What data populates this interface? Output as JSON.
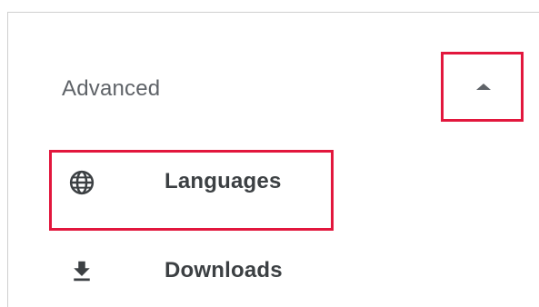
{
  "section": {
    "title": "Advanced",
    "toggle_icon": "arrow-up-icon"
  },
  "items": [
    {
      "label": "Languages",
      "icon": "globe-icon"
    },
    {
      "label": "Downloads",
      "icon": "download-icon"
    }
  ],
  "colors": {
    "highlight": "#e2173d",
    "text": "#3c4043",
    "icon": "#5f6368"
  }
}
